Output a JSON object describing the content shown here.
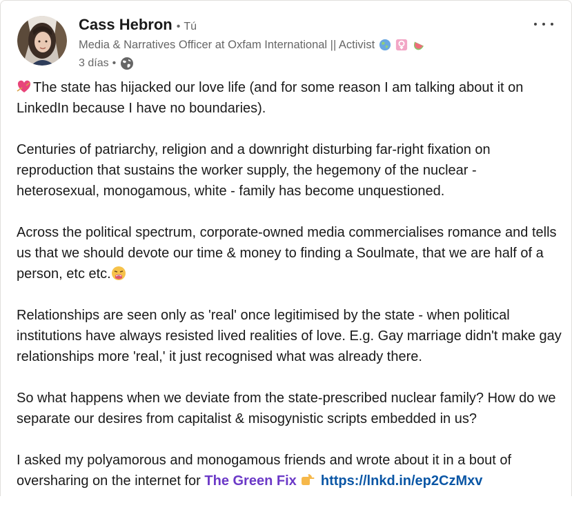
{
  "post": {
    "author": {
      "name": "Cass Hebron",
      "separator": "•",
      "relation": "Tú",
      "headline": "Media & Narratives Officer at Oxfam International || Activist",
      "headline_emojis": [
        "globe-emoji",
        "female-sign-emoji",
        "watermelon-emoji"
      ],
      "time": "3 días",
      "time_separator": "•",
      "visibility": "globe-icon"
    },
    "more_button_label": "More actions",
    "paragraphs": {
      "p1": "The state has hijacked our love life (and for some reason I am talking about it on LinkedIn because I have no boundaries).",
      "p2": "Centuries of patriarchy, religion and a downright disturbing far-right fixation on reproduction that sustains the worker supply, the hegemony of the nuclear - heterosexual, monogamous, white - family has become unquestioned.",
      "p3": "Across the political spectrum, corporate-owned media commercialises romance and tells us that we should devote our time & money to finding a Soulmate, that we are half of a person, etc etc.",
      "p4": "Relationships are seen only as 'real' once legitimised by the state - when political institutions have always resisted lived realities of love. E.g. Gay marriage didn't make gay relationships more 'real,' it just recognised what was already there.",
      "p5": "So what happens when we deviate from the state-prescribed nuclear family? How do we separate our desires from capitalist & misogynistic scripts embedded in us?",
      "p6_text": "I asked my polyamorous and monogamous friends and wrote about it in a bout of oversharing on the internet for ",
      "p6_mention": "The Green Fix",
      "p6_link": "https://lnkd.in/ep2CzMxv"
    },
    "colors": {
      "mention": "#6b39c7",
      "link": "#0a56a5",
      "secondary_text": "#666666"
    }
  }
}
